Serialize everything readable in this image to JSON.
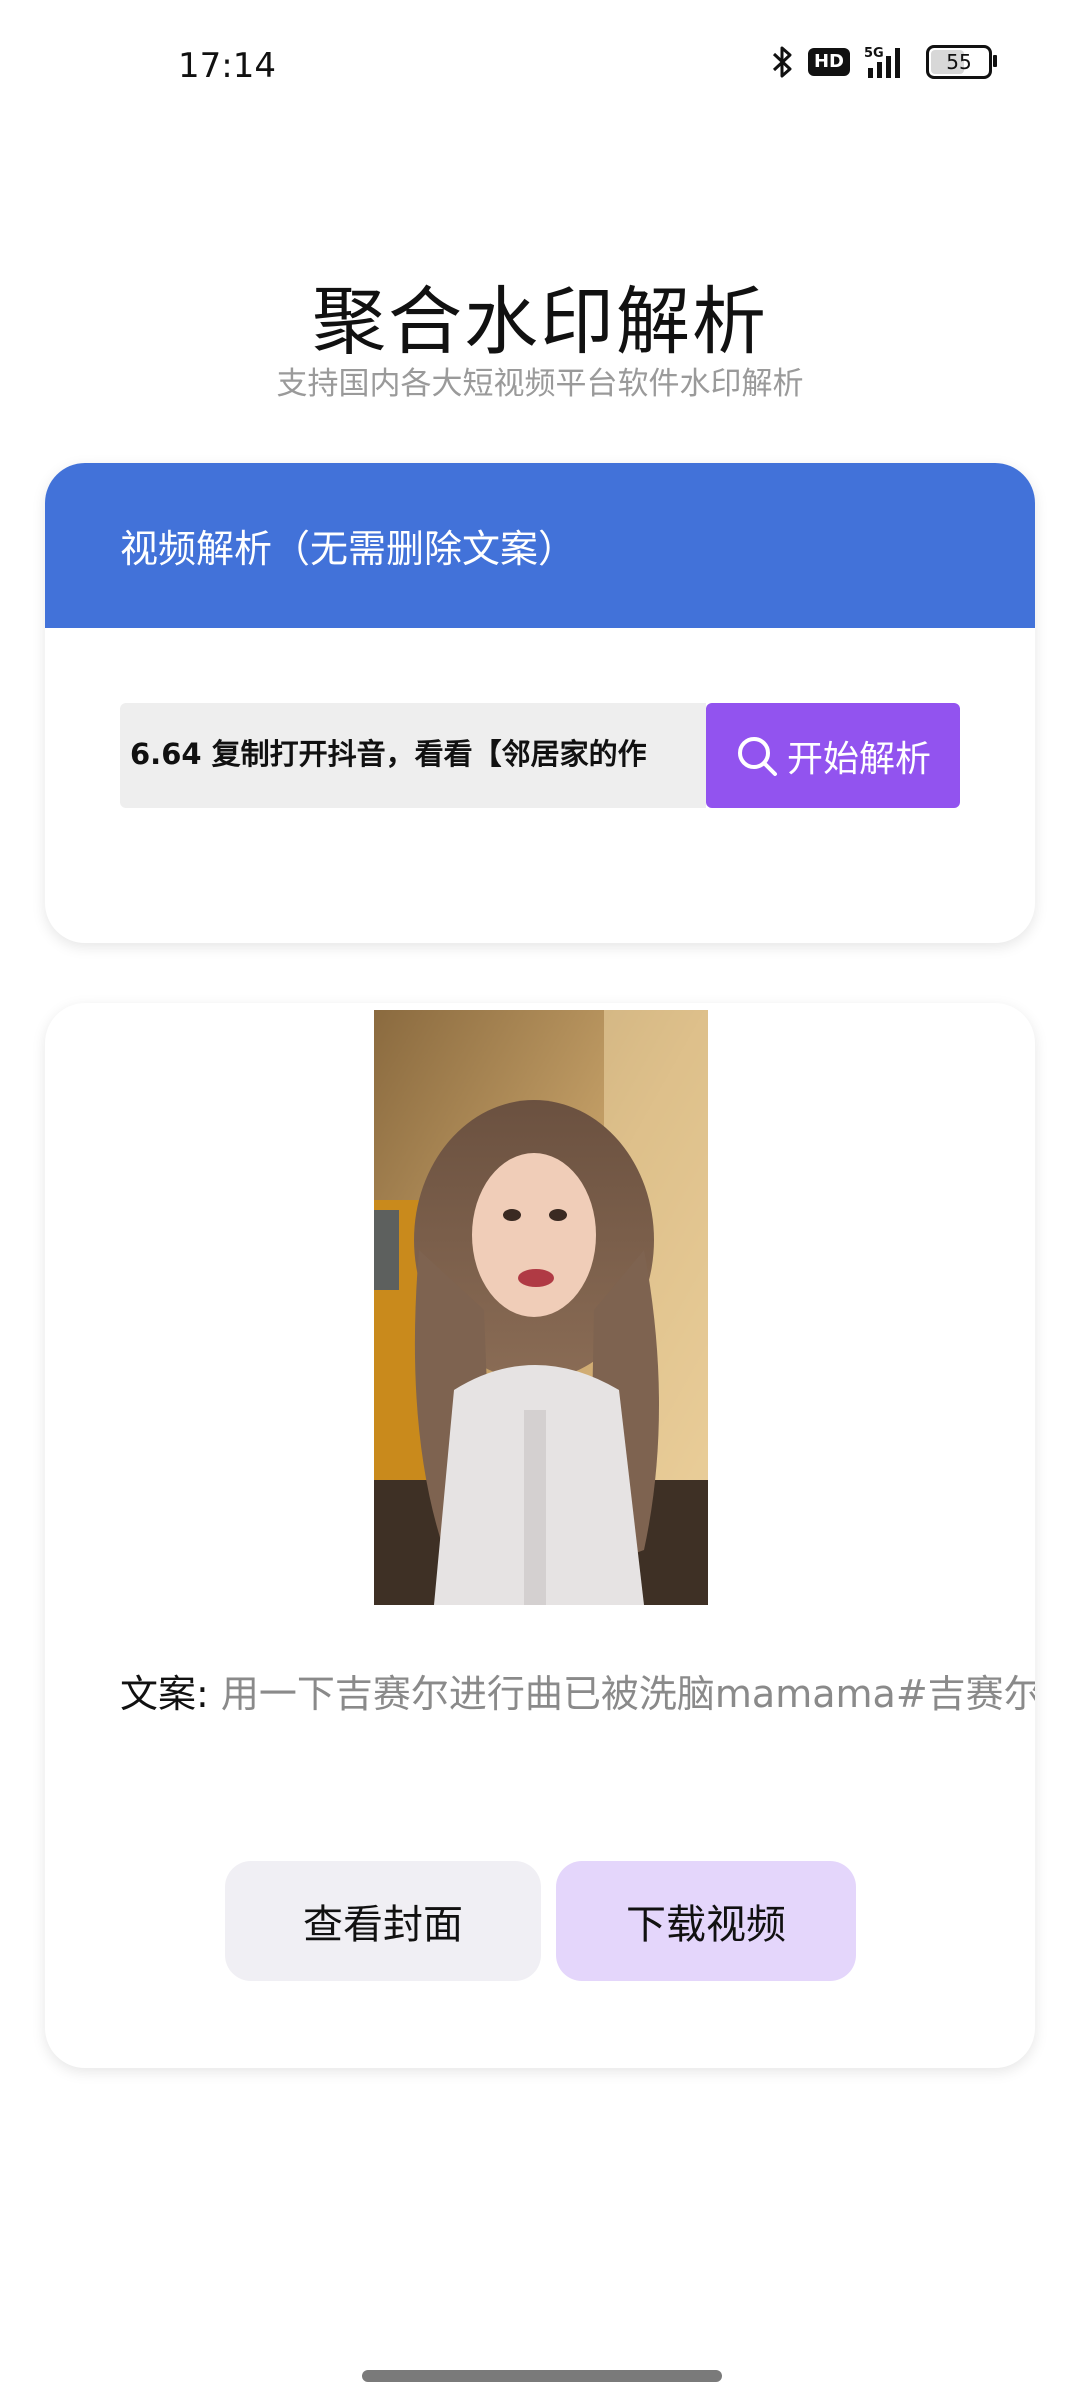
{
  "status_bar": {
    "time": "17:14",
    "network": "5G",
    "hd_label": "HD",
    "battery_level": "55",
    "icons": [
      "bluetooth-icon",
      "hd-icon",
      "signal-5g-icon",
      "battery-icon"
    ]
  },
  "header": {
    "title": "聚合水印解析",
    "subtitle": "支持国内各大短视频平台软件水印解析"
  },
  "parse_card": {
    "title": "视频解析（无需删除文案）",
    "input_value": "6.64 复制打开抖音，看看【邻居家的作",
    "button_label": "开始解析",
    "colors": {
      "header": "#4272d9",
      "button": "#9253ef"
    }
  },
  "result_card": {
    "caption_label": "文案:",
    "caption_text": "用一下吉赛尔进行曲已被洗脑mamama#吉赛尔",
    "buttons": {
      "cover": "查看封面",
      "download": "下载视频"
    }
  }
}
